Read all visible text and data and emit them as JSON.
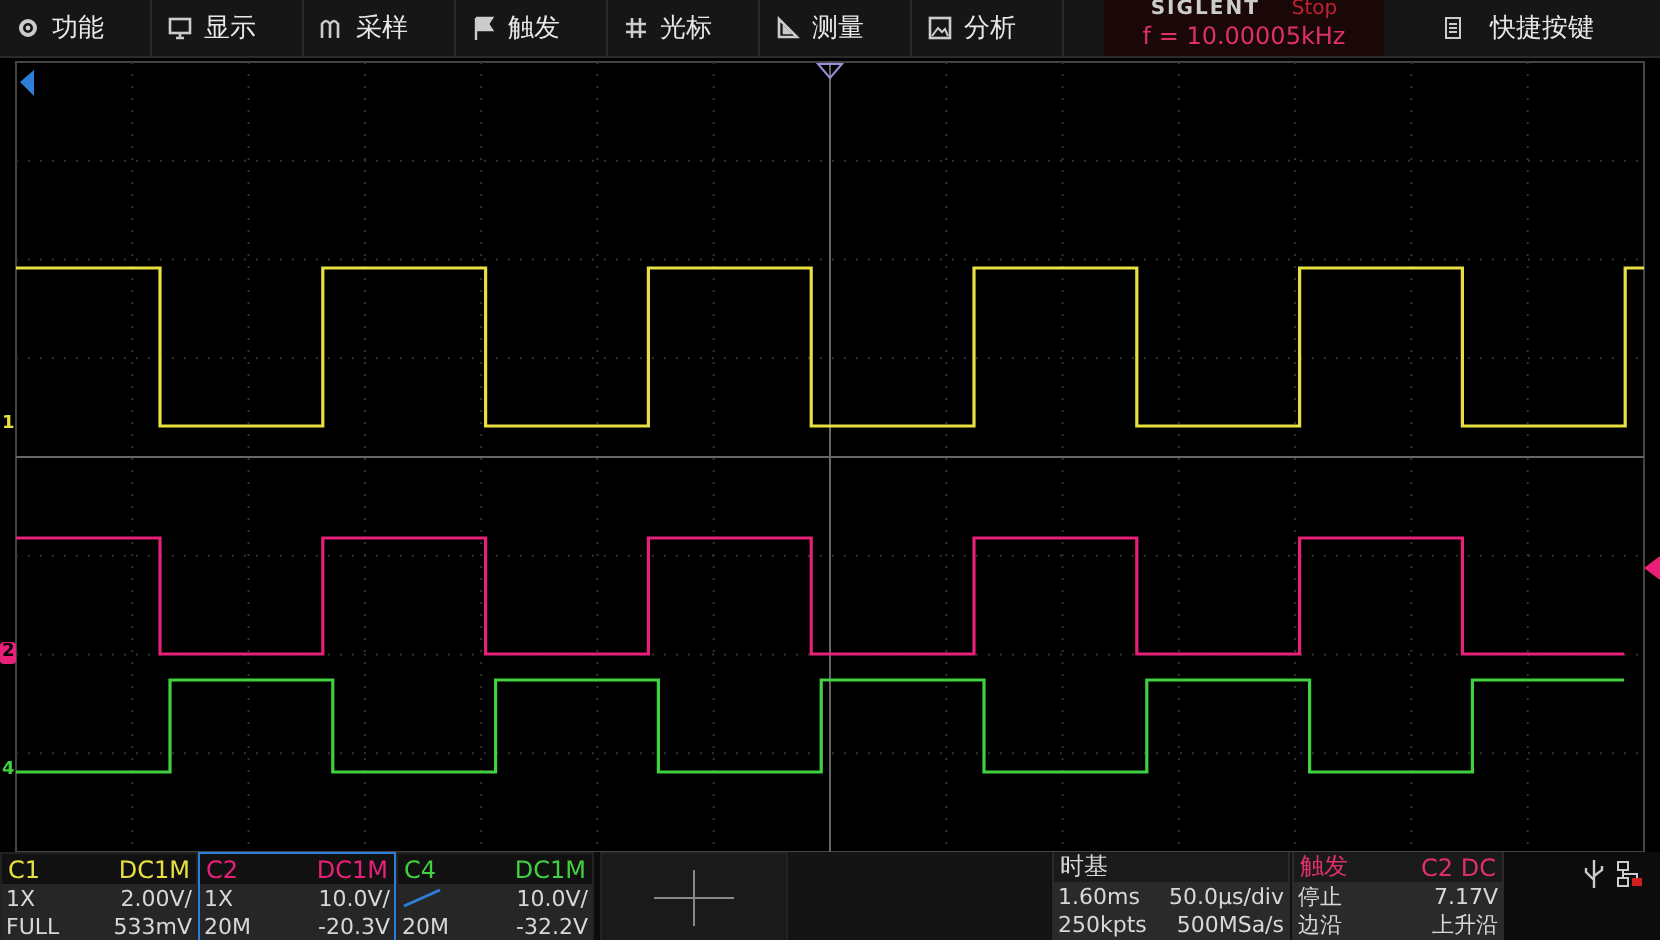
{
  "menu": [
    {
      "label": "功能",
      "kind": "gear"
    },
    {
      "label": "显示",
      "kind": "monitor"
    },
    {
      "label": "采样",
      "kind": "sample"
    },
    {
      "label": "触发",
      "kind": "flag"
    },
    {
      "label": "光标",
      "kind": "cursor"
    },
    {
      "label": "测量",
      "kind": "ruler"
    },
    {
      "label": "分析",
      "kind": "image"
    }
  ],
  "brand": {
    "logo": "SIGLENT",
    "status": "Stop",
    "frequency": "f = 10.00005kHz"
  },
  "shortcut": {
    "label": "快捷按键"
  },
  "channels": [
    {
      "name": "C1",
      "marker": "1",
      "color": "#e8e040",
      "coupling": "DC1M",
      "probe": "1X",
      "scale": "2.00V/",
      "bandwidth": "FULL",
      "offset": "533mV",
      "selected": false
    },
    {
      "name": "C2",
      "marker": "2",
      "color": "#e8207a",
      "coupling": "DC1M",
      "probe": "1X",
      "scale": "10.0V/",
      "bandwidth": "20M",
      "offset": "-20.3V",
      "selected": true
    },
    {
      "name": "C4",
      "marker": "4",
      "color": "#40d040",
      "coupling": "DC1M",
      "scale": "10.0V/",
      "bandwidth": "20M",
      "offset": "-32.2V",
      "selected": false
    }
  ],
  "timebase": {
    "title": "时基",
    "delay": "1.60ms",
    "scale": "50.0μs/div",
    "memory": "250kpts",
    "rate": "500MSa/s"
  },
  "trigger": {
    "title": "触发",
    "source": "C2 DC",
    "state": "停止",
    "level": "7.17V",
    "type": "边沿",
    "slope": "上升沿"
  }
}
